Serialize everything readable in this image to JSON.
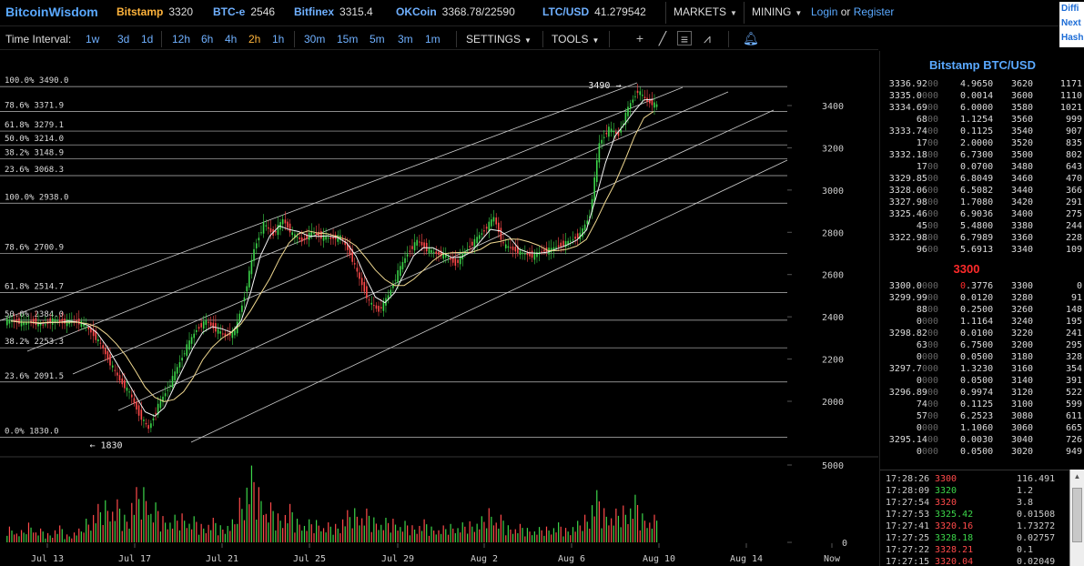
{
  "brand": "BitcoinWisdom",
  "tickers": [
    {
      "exchange": "Bitstamp",
      "value": "3320",
      "x": 128,
      "color": "orange"
    },
    {
      "exchange": "BTC-e",
      "value": "2546",
      "x": 234,
      "color": "blue"
    },
    {
      "exchange": "Bitfinex",
      "value": "3315.4",
      "x": 323,
      "color": "blue"
    },
    {
      "exchange": "OKCoin",
      "value": "3368.78/22590",
      "x": 435,
      "color": "blue"
    },
    {
      "exchange": "LTC/USD",
      "value": "41.279542",
      "x": 596,
      "color": "blue"
    }
  ],
  "menus": {
    "markets": "MARKETS",
    "mining": "MINING",
    "login": "Login",
    "or": "or",
    "register": "Register"
  },
  "rightbox": [
    "Diffi",
    "Next",
    "Hash"
  ],
  "toolbar": {
    "interval_label": "Time Interval:",
    "intervals": [
      "1w",
      "3d",
      "1d",
      "12h",
      "6h",
      "4h",
      "2h",
      "1h",
      "30m",
      "15m",
      "5m",
      "3m",
      "1m"
    ],
    "active_interval": "2h",
    "settings": "SETTINGS",
    "tools": "TOOLS"
  },
  "chart_data": {
    "type": "candlestick",
    "title": "",
    "y_axis_ticks": [
      3400,
      3200,
      3000,
      2800,
      2600,
      2400,
      2200,
      2000
    ],
    "volume_ticks": [
      5000,
      0
    ],
    "x_axis_ticks": [
      "Jul 13",
      "Jul 17",
      "Jul 21",
      "Jul 25",
      "Jul 29",
      "Aug 2",
      "Aug 6",
      "Aug 10",
      "Aug 14",
      "Now"
    ],
    "ylim": [
      1790,
      3530
    ],
    "fib_levels": [
      {
        "label": "100.0% 3490.0",
        "value": 3490.0
      },
      {
        "label": "78.6% 3371.9",
        "value": 3371.9
      },
      {
        "label": "61.8% 3279.1",
        "value": 3279.1
      },
      {
        "label": "50.0% 3214.0",
        "value": 3214.0
      },
      {
        "label": "38.2% 3148.9",
        "value": 3148.9
      },
      {
        "label": "23.6% 3068.3",
        "value": 3068.3
      },
      {
        "label": "100.0% 2938.0",
        "value": 2938.0
      },
      {
        "label": "78.6% 2700.9",
        "value": 2700.9
      },
      {
        "label": "61.8% 2514.7",
        "value": 2514.7
      },
      {
        "label": "50.0% 2384.0",
        "value": 2384.0
      },
      {
        "label": "38.2% 2253.3",
        "value": 2253.3
      },
      {
        "label": "23.6% 2091.5",
        "value": 2091.5
      },
      {
        "label": "0.0% 1830.0",
        "value": 1830.0
      }
    ],
    "annotations": [
      {
        "text": "3490 →",
        "x_index": 64,
        "value": 3490
      },
      {
        "text": "← 1830",
        "x_index": 12,
        "value": 1830
      }
    ],
    "price_path": [
      2380,
      2370,
      2375,
      2360,
      2385,
      2375,
      2380,
      2370,
      2330,
      2270,
      2180,
      2100,
      2040,
      1940,
      1870,
      1980,
      2060,
      2160,
      2260,
      2340,
      2380,
      2340,
      2310,
      2330,
      2500,
      2720,
      2840,
      2790,
      2860,
      2790,
      2760,
      2800,
      2780,
      2770,
      2780,
      2700,
      2580,
      2470,
      2430,
      2500,
      2610,
      2700,
      2760,
      2720,
      2700,
      2690,
      2650,
      2710,
      2760,
      2810,
      2870,
      2740,
      2720,
      2700,
      2690,
      2710,
      2720,
      2740,
      2760,
      2790,
      2880,
      3220,
      3290,
      3260,
      3390,
      3470,
      3420,
      3400
    ],
    "volumes": [
      1200,
      800,
      1500,
      900,
      700,
      1100,
      600,
      900,
      1800,
      2500,
      3200,
      2800,
      2100,
      3600,
      4200,
      2600,
      2000,
      1800,
      2200,
      1700,
      1400,
      1600,
      1300,
      1500,
      3400,
      5000,
      4200,
      2600,
      2200,
      2500,
      1800,
      1500,
      1700,
      1300,
      1400,
      2100,
      2600,
      2200,
      1900,
      1600,
      1800,
      1400,
      1300,
      1500,
      1200,
      1100,
      1400,
      1300,
      1600,
      1700,
      2600,
      1800,
      1300,
      1200,
      1100,
      1000,
      1200,
      1300,
      1100,
      1400,
      2100,
      3400,
      2600,
      2200,
      2800,
      3100,
      2200,
      1800
    ]
  },
  "orderbook": {
    "title": "Bitstamp BTC/USD",
    "asks": [
      {
        "price": "3336.92",
        "dim": "00",
        "amt": "4.9650",
        "lvl": "3620",
        "cum": "1171"
      },
      {
        "price": "3335.0",
        "dim": "000",
        "amt": "0.0014",
        "lvl": "3600",
        "cum": "1110"
      },
      {
        "price": "3334.69",
        "dim": "00",
        "amt": "6.0000",
        "lvl": "3580",
        "cum": "1021"
      },
      {
        "price": "68",
        "dim": "00",
        "amt": "1.1254",
        "lvl": "3560",
        "cum": "999"
      },
      {
        "price": "3333.74",
        "dim": "00",
        "amt": "0.1125",
        "lvl": "3540",
        "cum": "907"
      },
      {
        "price": "17",
        "dim": "00",
        "amt": "2.0000",
        "lvl": "3520",
        "cum": "835"
      },
      {
        "price": "3332.18",
        "dim": "00",
        "amt": "6.7300",
        "lvl": "3500",
        "cum": "802"
      },
      {
        "price": "17",
        "dim": "00",
        "amt": "0.0700",
        "lvl": "3480",
        "cum": "643"
      },
      {
        "price": "3329.85",
        "dim": "00",
        "amt": "6.8049",
        "lvl": "3460",
        "cum": "470"
      },
      {
        "price": "3328.06",
        "dim": "00",
        "amt": "6.5082",
        "lvl": "3440",
        "cum": "366"
      },
      {
        "price": "3327.98",
        "dim": "00",
        "amt": "1.7080",
        "lvl": "3420",
        "cum": "291"
      },
      {
        "price": "3325.46",
        "dim": "00",
        "amt": "6.9036",
        "lvl": "3400",
        "cum": "275"
      },
      {
        "price": "45",
        "dim": "00",
        "amt": "5.4800",
        "lvl": "3380",
        "cum": "244"
      },
      {
        "price": "3322.98",
        "dim": "00",
        "amt": "6.7989",
        "lvl": "3360",
        "cum": "228"
      },
      {
        "price": "96",
        "dim": "00",
        "amt": "5.6913",
        "lvl": "3340",
        "cum": "109"
      }
    ],
    "mid": "3300",
    "bids": [
      {
        "price": "3300.0",
        "dim": "000",
        "amt": "0.3776",
        "lvl": "3300",
        "cum": "0"
      },
      {
        "price": "3299.99",
        "dim": "00",
        "amt": "0.0120",
        "lvl": "3280",
        "cum": "91"
      },
      {
        "price": "88",
        "dim": "00",
        "amt": "0.2500",
        "lvl": "3260",
        "cum": "148"
      },
      {
        "price": "0",
        "dim": "000",
        "amt": "1.1164",
        "lvl": "3240",
        "cum": "195"
      },
      {
        "price": "3298.82",
        "dim": "00",
        "amt": "0.0100",
        "lvl": "3220",
        "cum": "241"
      },
      {
        "price": "63",
        "dim": "00",
        "amt": "6.7500",
        "lvl": "3200",
        "cum": "295"
      },
      {
        "price": "0",
        "dim": "000",
        "amt": "0.0500",
        "lvl": "3180",
        "cum": "328"
      },
      {
        "price": "3297.7",
        "dim": "000",
        "amt": "1.3230",
        "lvl": "3160",
        "cum": "354"
      },
      {
        "price": "0",
        "dim": "000",
        "amt": "0.0500",
        "lvl": "3140",
        "cum": "391"
      },
      {
        "price": "3296.89",
        "dim": "00",
        "amt": "0.9974",
        "lvl": "3120",
        "cum": "522"
      },
      {
        "price": "74",
        "dim": "00",
        "amt": "0.1125",
        "lvl": "3100",
        "cum": "599"
      },
      {
        "price": "57",
        "dim": "00",
        "amt": "6.2523",
        "lvl": "3080",
        "cum": "611"
      },
      {
        "price": "0",
        "dim": "000",
        "amt": "1.1060",
        "lvl": "3060",
        "cum": "665"
      },
      {
        "price": "3295.14",
        "dim": "00",
        "amt": "0.0030",
        "lvl": "3040",
        "cum": "726"
      },
      {
        "price": "0",
        "dim": "000",
        "amt": "0.0500",
        "lvl": "3020",
        "cum": "949"
      }
    ]
  },
  "trades": [
    {
      "time": "17:28:26",
      "price": "3300",
      "dir": "down",
      "amt": "116.491"
    },
    {
      "time": "17:28:09",
      "price": "3320",
      "dir": "up",
      "amt": "1.2"
    },
    {
      "time": "17:27:54",
      "price": "3320",
      "dir": "down",
      "amt": "3.8"
    },
    {
      "time": "17:27:53",
      "price": "3325.42",
      "dir": "up",
      "amt": "0.01508"
    },
    {
      "time": "17:27:41",
      "price": "3320.16",
      "dir": "down",
      "amt": "1.73272"
    },
    {
      "time": "17:27:25",
      "price": "3328.18",
      "dir": "up",
      "amt": "0.02757"
    },
    {
      "time": "17:27:22",
      "price": "3328.21",
      "dir": "down",
      "amt": "0.1"
    },
    {
      "time": "17:27:15",
      "price": "3320.04",
      "dir": "down",
      "amt": "0.02049"
    }
  ],
  "colors": {
    "up": "#3cd64a",
    "down": "#ff4a4a",
    "accent": "#5aa9ff",
    "orange": "#ffb43c"
  }
}
